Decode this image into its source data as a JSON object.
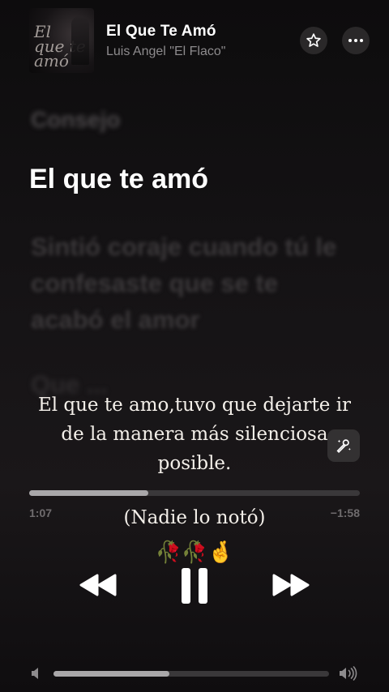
{
  "header": {
    "title": "El Que Te Amó",
    "artist": "Luis Angel \"El Flaco\"",
    "artwork_text": "El que te amó",
    "favorite_icon": "star-icon",
    "more_icon": "ellipsis-icon"
  },
  "lyrics": {
    "previous": "Consejo",
    "current": "El que te amó",
    "next": "Sintió coraje cuando tú le confesaste que se te acabó el amor",
    "next2": "Que ..."
  },
  "overlay": {
    "quote": "El que te amo,tuvo que dejarte ir de la manera más silenciosa posible.",
    "note": "(Nadie lo notó)",
    "emoji": "🥀🥀🤞"
  },
  "playback": {
    "elapsed": "1:07",
    "remaining": "−1:58",
    "progress_fraction": 0.36
  },
  "volume": {
    "level_fraction": 0.42
  }
}
